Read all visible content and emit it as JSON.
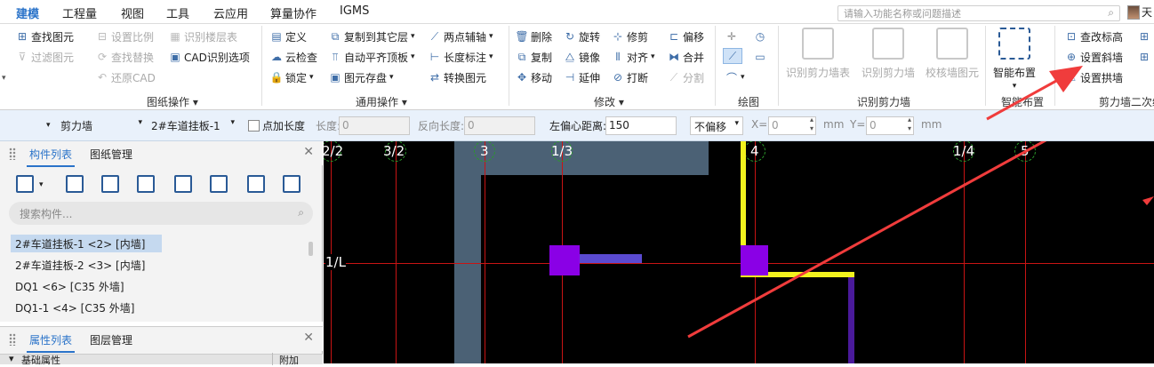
{
  "menu": {
    "items": [
      "建模",
      "工程量",
      "视图",
      "工具",
      "云应用",
      "算量协作",
      "IGMS"
    ],
    "active": "建模",
    "search_placeholder": "请输入功能名称或问题描述",
    "user_label": "天"
  },
  "ribbon": {
    "drawing_ops": {
      "label": "图纸操作",
      "buttons": [
        "查找图元",
        "过滤图元",
        "设置比例",
        "还原CAD",
        "查找替换",
        "识别楼层表",
        "CAD识别选项"
      ]
    },
    "common_ops": {
      "label": "通用操作",
      "buttons": [
        "定义",
        "云检查",
        "锁定",
        "复制到其它层",
        "自动平齐顶板",
        "图元存盘",
        "两点辅轴",
        "长度标注",
        "转换图元"
      ]
    },
    "modify": {
      "label": "修改",
      "buttons": [
        "删除",
        "旋转",
        "修剪",
        "偏移",
        "复制",
        "镜像",
        "对齐",
        "合并",
        "移动",
        "延伸",
        "打断",
        "分割"
      ]
    },
    "draw": {
      "label": "绘图"
    },
    "identify_shear": {
      "label": "识别剪力墙",
      "buttons": [
        "识别剪力墙表",
        "识别剪力墙",
        "校核墙图元"
      ]
    },
    "smart": {
      "label": "智能布置",
      "button": "智能布置"
    },
    "shear_second": {
      "label": "剪力墙二次编辑",
      "buttons": [
        "查改标高",
        "设置斜墙",
        "设置拱墙"
      ]
    }
  },
  "propbar": {
    "type_select": "剪力墙",
    "component_select": "2#车道挂板-1",
    "add_length_label": "点加长度",
    "length_label": "长度:",
    "length_value": "0",
    "reverse_length_label": "反向长度:",
    "reverse_length_value": "0",
    "offset_label": "左偏心距离:",
    "offset_value": "150",
    "no_offset_select": "不偏移",
    "x_label": "X=",
    "x_value": "0",
    "y_label": "Y=",
    "y_value": "0",
    "unit_mm": "mm"
  },
  "component_panel": {
    "tabs": [
      "构件列表",
      "图纸管理"
    ],
    "search_placeholder": "搜索构件...",
    "items": [
      "2#车道挂板-1 <2> [内墙]",
      "2#车道挂板-2 <3> [内墙]",
      "DQ1 <6> [C35 外墙]",
      "DQ1-1 <4> [C35 外墙]"
    ],
    "selected_index": 0
  },
  "property_panel": {
    "tabs": [
      "属性列表",
      "图层管理"
    ],
    "row_label": "基础属性",
    "col_label": "附加"
  },
  "canvas": {
    "axis_labels": [
      "2/2",
      "3/2",
      "3",
      "1/3",
      "4",
      "1/4",
      "5"
    ],
    "row_label": "1/L",
    "colors": {
      "background": "#000000",
      "grid": "#c81414",
      "wall_gray": "#4b6175",
      "wall_yellow": "#f2f21e",
      "column": "#8a00e6",
      "beam": "#5a4ad0",
      "arrow": "#f03c3c"
    }
  }
}
